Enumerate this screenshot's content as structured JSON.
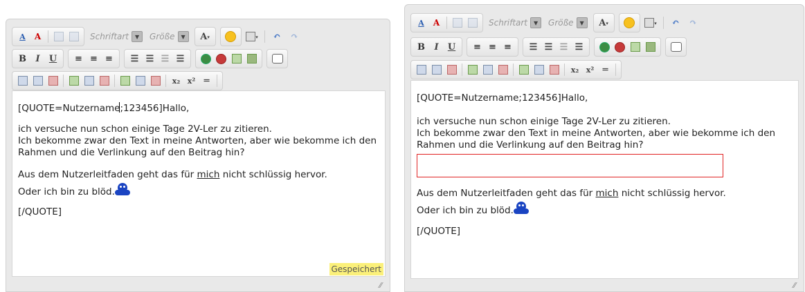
{
  "editor_left": {
    "toolbar": {
      "font_label": "Schriftart",
      "size_label": "Größe"
    },
    "content": {
      "quote_open_a": "[QUOTE=Nutzername",
      "quote_open_b": ";123456]Hallo,",
      "para1_line1": "ich versuche nun schon einige Tage 2V-Ler zu zitieren.",
      "para1_line2": "Ich bekomme zwar den Text in meine Antworten, aber wie bekomme ich den",
      "para1_line3": "Rahmen und die Verlinkung auf den Beitrag hin?",
      "para2_pre": "Aus dem Nutzerleitfaden geht das für ",
      "para2_link": "mich",
      "para2_post": " nicht schlüssig hervor.",
      "para3": "Oder ich bin zu blöd.",
      "quote_close": "[/QUOTE]"
    },
    "status": "Gespeichert"
  },
  "editor_right": {
    "toolbar": {
      "font_label": "Schriftart",
      "size_label": "Größe"
    },
    "content": {
      "quote_open": "[QUOTE=Nutzername;123456]Hallo,",
      "para1_line1": "ich versuche nun schon einige Tage 2V-Ler zu zitieren.",
      "para1_line2": "Ich bekomme zwar den Text in meine Antworten, aber wie bekomme ich den",
      "para1_line3": "Rahmen und die Verlinkung auf den Beitrag hin?",
      "para2_pre": "Aus dem Nutzerleitfaden geht das für ",
      "para2_link": "mich",
      "para2_post": " nicht schlüssig hervor.",
      "para3": "Oder ich bin zu blöd.",
      "quote_close": "[/QUOTE]"
    }
  },
  "icons": [
    "font-color-icon",
    "remove-format-icon",
    "paste-icon",
    "paste-text-icon",
    "font-select-icon",
    "size-select-icon",
    "text-color-icon",
    "smiley-icon",
    "clipboard-icon",
    "undo-icon",
    "redo-icon",
    "bold-icon",
    "italic-icon",
    "underline-icon",
    "align-left-icon",
    "align-center-icon",
    "align-right-icon",
    "ordered-list-icon",
    "unordered-list-icon",
    "outdent-icon",
    "indent-icon",
    "link-icon",
    "unlink-icon",
    "image-icon",
    "video-icon",
    "quote-icon",
    "table-icon",
    "subscript-icon",
    "superscript-icon",
    "horizontal-rule-icon"
  ],
  "colors": {
    "status_highlight": "#fbf07a",
    "highlight_box": "#e02020",
    "emoji": "#1a44c2"
  }
}
